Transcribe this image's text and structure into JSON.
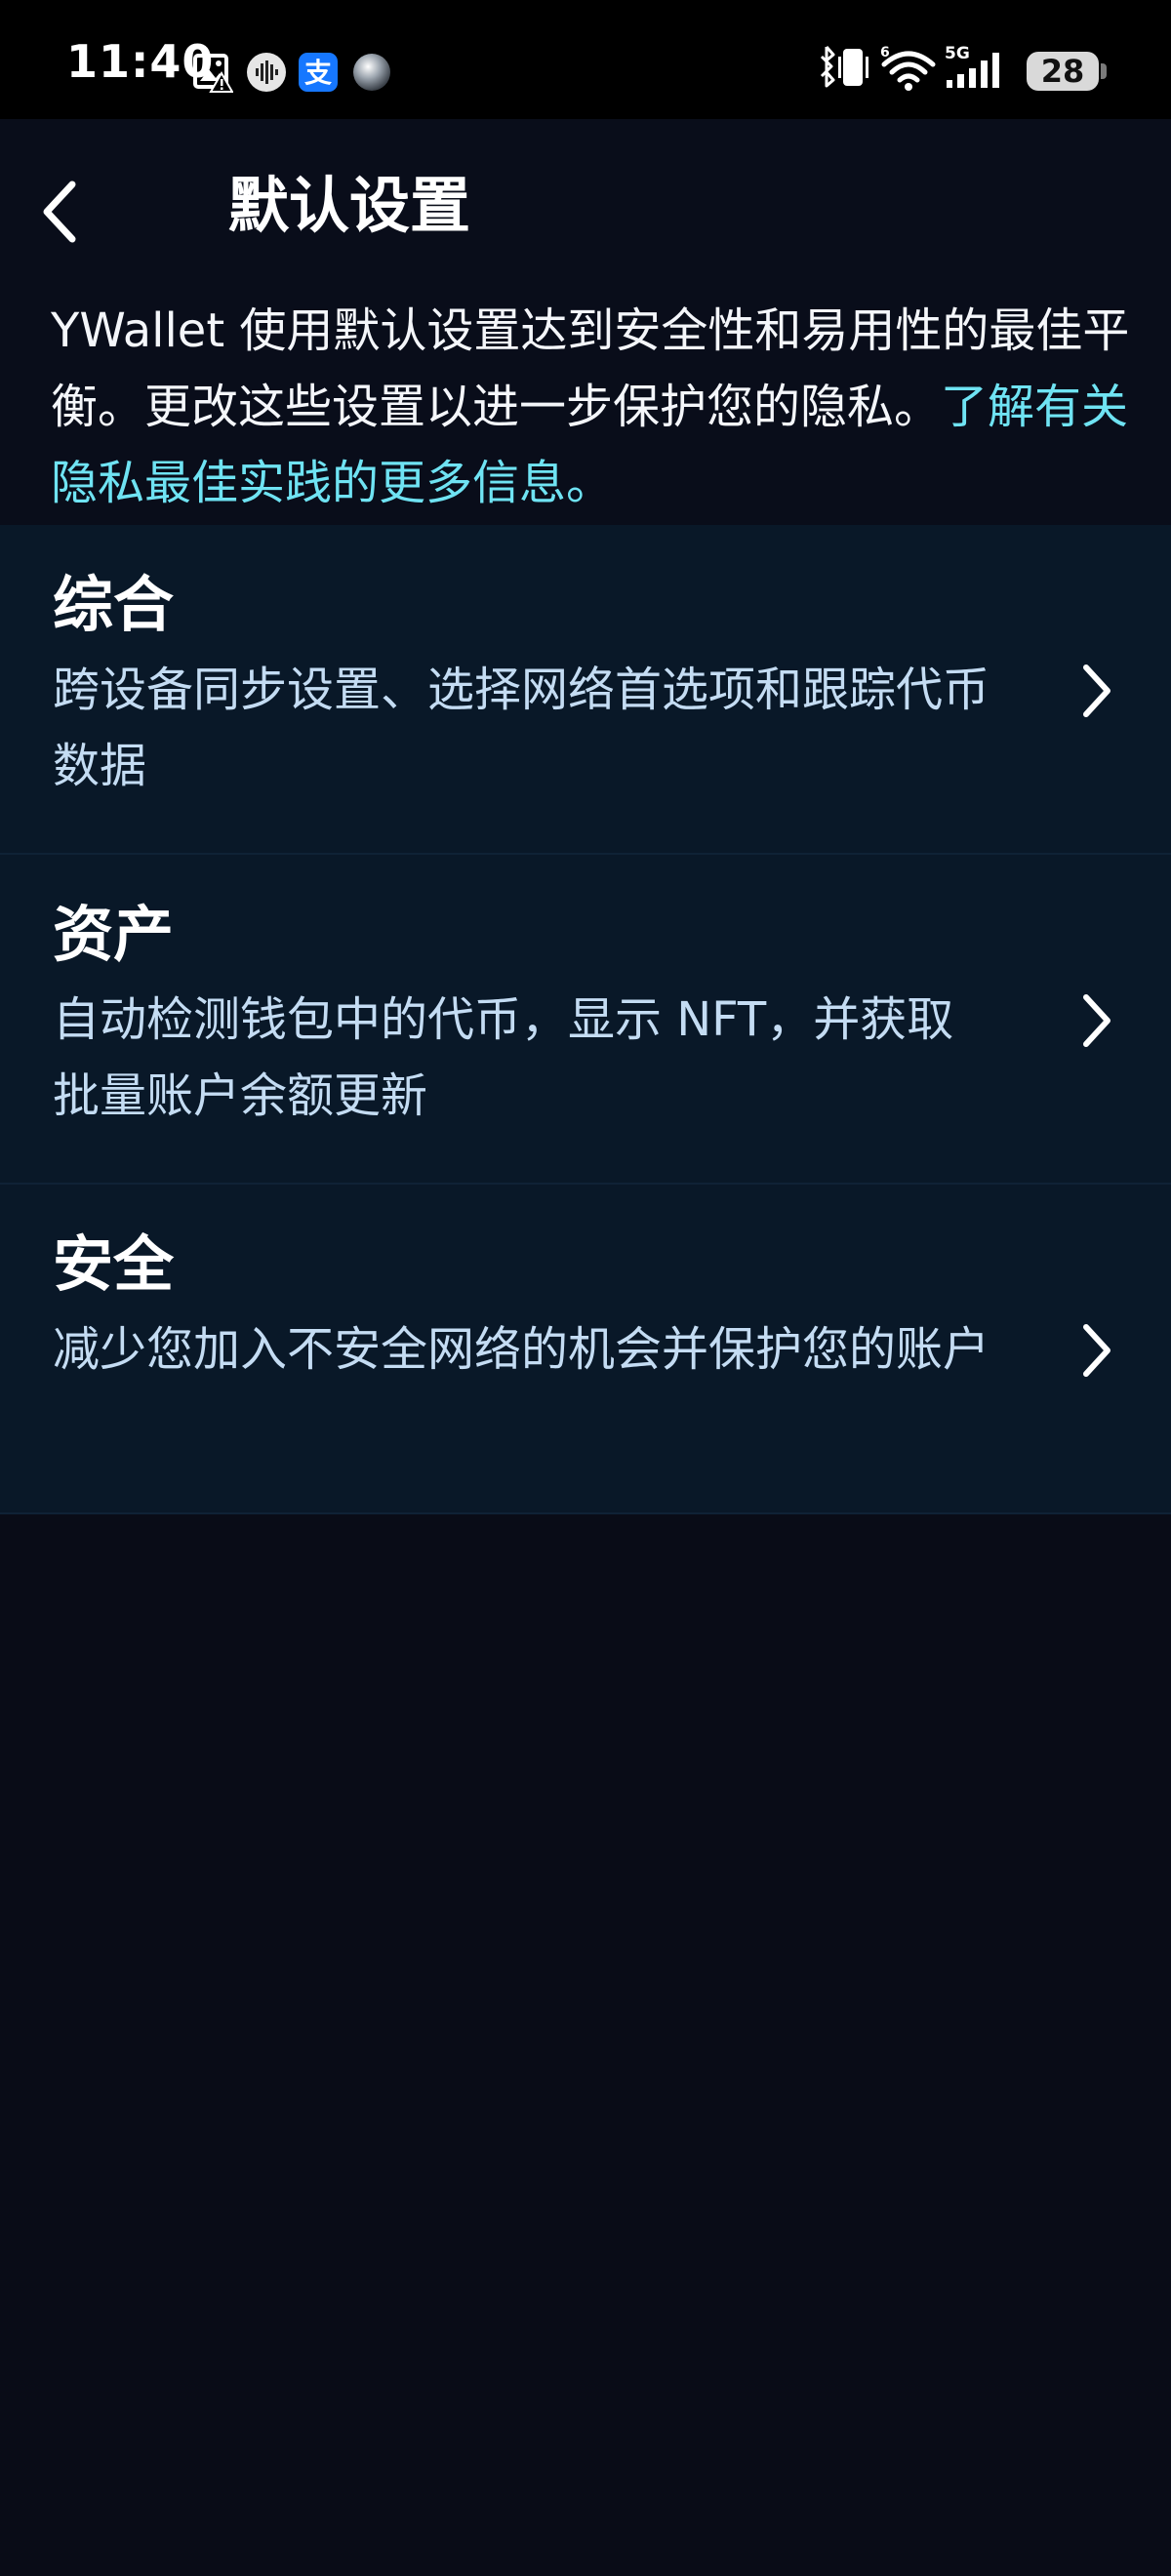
{
  "status_bar": {
    "time": "11:40",
    "battery": "28",
    "network": "5G",
    "notification_icons": [
      "gallery-alert-icon",
      "audio-wave-icon",
      "alipay-icon",
      "sphere-app-icon"
    ],
    "system_icons": [
      "bluetooth-vibrate-icon",
      "wifi-icon",
      "signal-icon"
    ]
  },
  "header": {
    "title": "默认设置",
    "intro_text": "YWallet 使用默认设置达到安全性和易用性的最佳平衡。更改这些设置以进一步保护您的隐私。",
    "intro_link": "了解有关隐私最佳实践的更多信息。"
  },
  "settings": [
    {
      "title": "综合",
      "description": "跨设备同步设置、选择网络首选项和跟踪代币数据"
    },
    {
      "title": "资产",
      "description": "自动检测钱包中的代币，显示 NFT，并获取批量账户余额更新"
    },
    {
      "title": "安全",
      "description": "减少您加入不安全网络的机会并保护您的账户"
    }
  ],
  "colors": {
    "background": "#090c17",
    "item_background": "#091828",
    "link": "#6fe3f3",
    "description": "#c4dcf3"
  }
}
